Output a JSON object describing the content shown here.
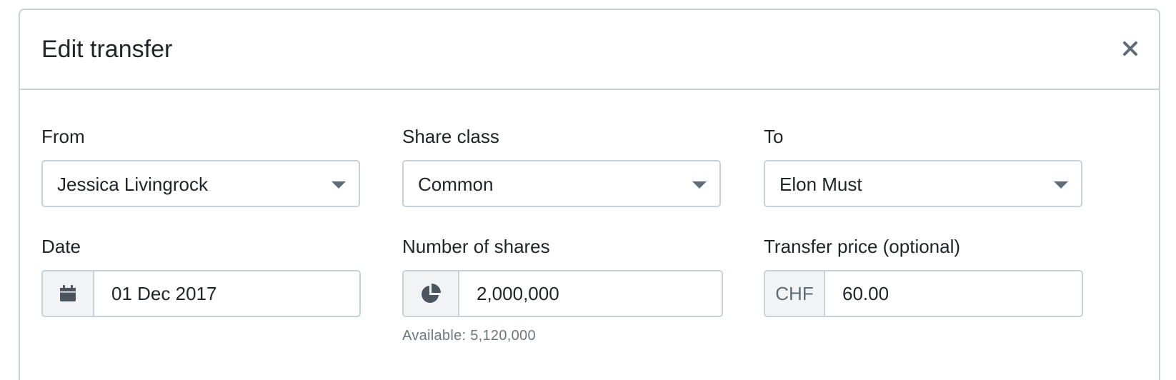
{
  "modal": {
    "title": "Edit transfer",
    "close_icon": "close-icon"
  },
  "from": {
    "label": "From",
    "value": "Jessica Livingrock"
  },
  "share_class": {
    "label": "Share class",
    "value": "Common"
  },
  "to": {
    "label": "To",
    "value": "Elon Must"
  },
  "date": {
    "label": "Date",
    "icon": "calendar-icon",
    "value": "01 Dec 2017"
  },
  "shares": {
    "label": "Number of shares",
    "icon": "pie-chart-icon",
    "value": "2,000,000",
    "help": "Available: 5,120,000"
  },
  "price": {
    "label": "Transfer price (optional)",
    "currency": "CHF",
    "value": "60.00"
  },
  "colors": {
    "border": "#c8d1d8",
    "addon_bg": "#f1f3f5",
    "icon": "#4a5560",
    "text": "#212529",
    "muted": "#6c757d"
  }
}
